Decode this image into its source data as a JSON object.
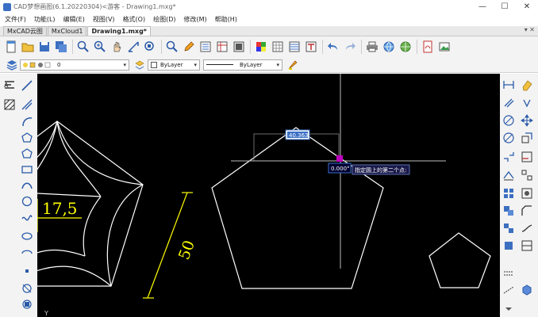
{
  "window": {
    "title": "CAD梦想画图(6.1.20220304)<游客 - Drawing1.mxg*",
    "minimize": "—",
    "maximize": "☐",
    "close": "✕"
  },
  "menu": [
    "文件(F)",
    "功能(L)",
    "编辑(E)",
    "视图(V)",
    "格式(O)",
    "绘图(D)",
    "修改(M)",
    "帮助(H)"
  ],
  "tabs": [
    "MxCAD云图",
    "MxCloud1",
    "Drawing1.mxg*"
  ],
  "tab_controls": "▾ ✕",
  "layer_combo": {
    "value": "0"
  },
  "color_combo": {
    "value": "ByLayer"
  },
  "linetype_combo": {
    "value": "ByLayer"
  },
  "canvas": {
    "dim_text_1": "17,5",
    "dim_text_2": "50",
    "input_length": "40.363",
    "input_angle": "0.000°",
    "prompt": "指定圆上的第二个点:",
    "axis_label": "Y"
  },
  "colors": {
    "canvas_bg": "#000000",
    "geometry": "#ffffff",
    "dimension": "#ffff00",
    "cursor": "#c000c0",
    "input_bg": "#ffffff",
    "input_border": "#3a6fc4"
  }
}
